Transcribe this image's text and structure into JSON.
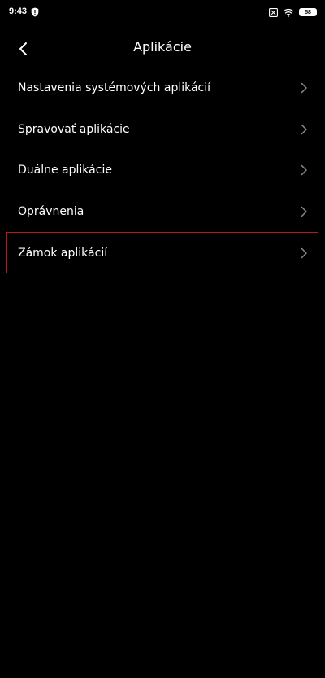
{
  "status_bar": {
    "time": "9:43",
    "battery": "58",
    "icons": [
      "shield-icon",
      "sim-off-icon",
      "wifi-icon",
      "battery-icon"
    ]
  },
  "header": {
    "title": "Aplikácie",
    "back_icon": "chevron-left-icon"
  },
  "menu": {
    "items": [
      {
        "label": "Nastavenia systémových aplikácií"
      },
      {
        "label": "Spravovať aplikácie"
      },
      {
        "label": "Duálne aplikácie"
      },
      {
        "label": "Oprávnenia"
      },
      {
        "label": "Zámok aplikácií"
      }
    ],
    "chevron_icon": "chevron-right-icon"
  },
  "colors": {
    "background": "#000000",
    "text": "#ffffff",
    "chevron": "#8a8a8a",
    "highlight_border": "#b81a1a"
  }
}
